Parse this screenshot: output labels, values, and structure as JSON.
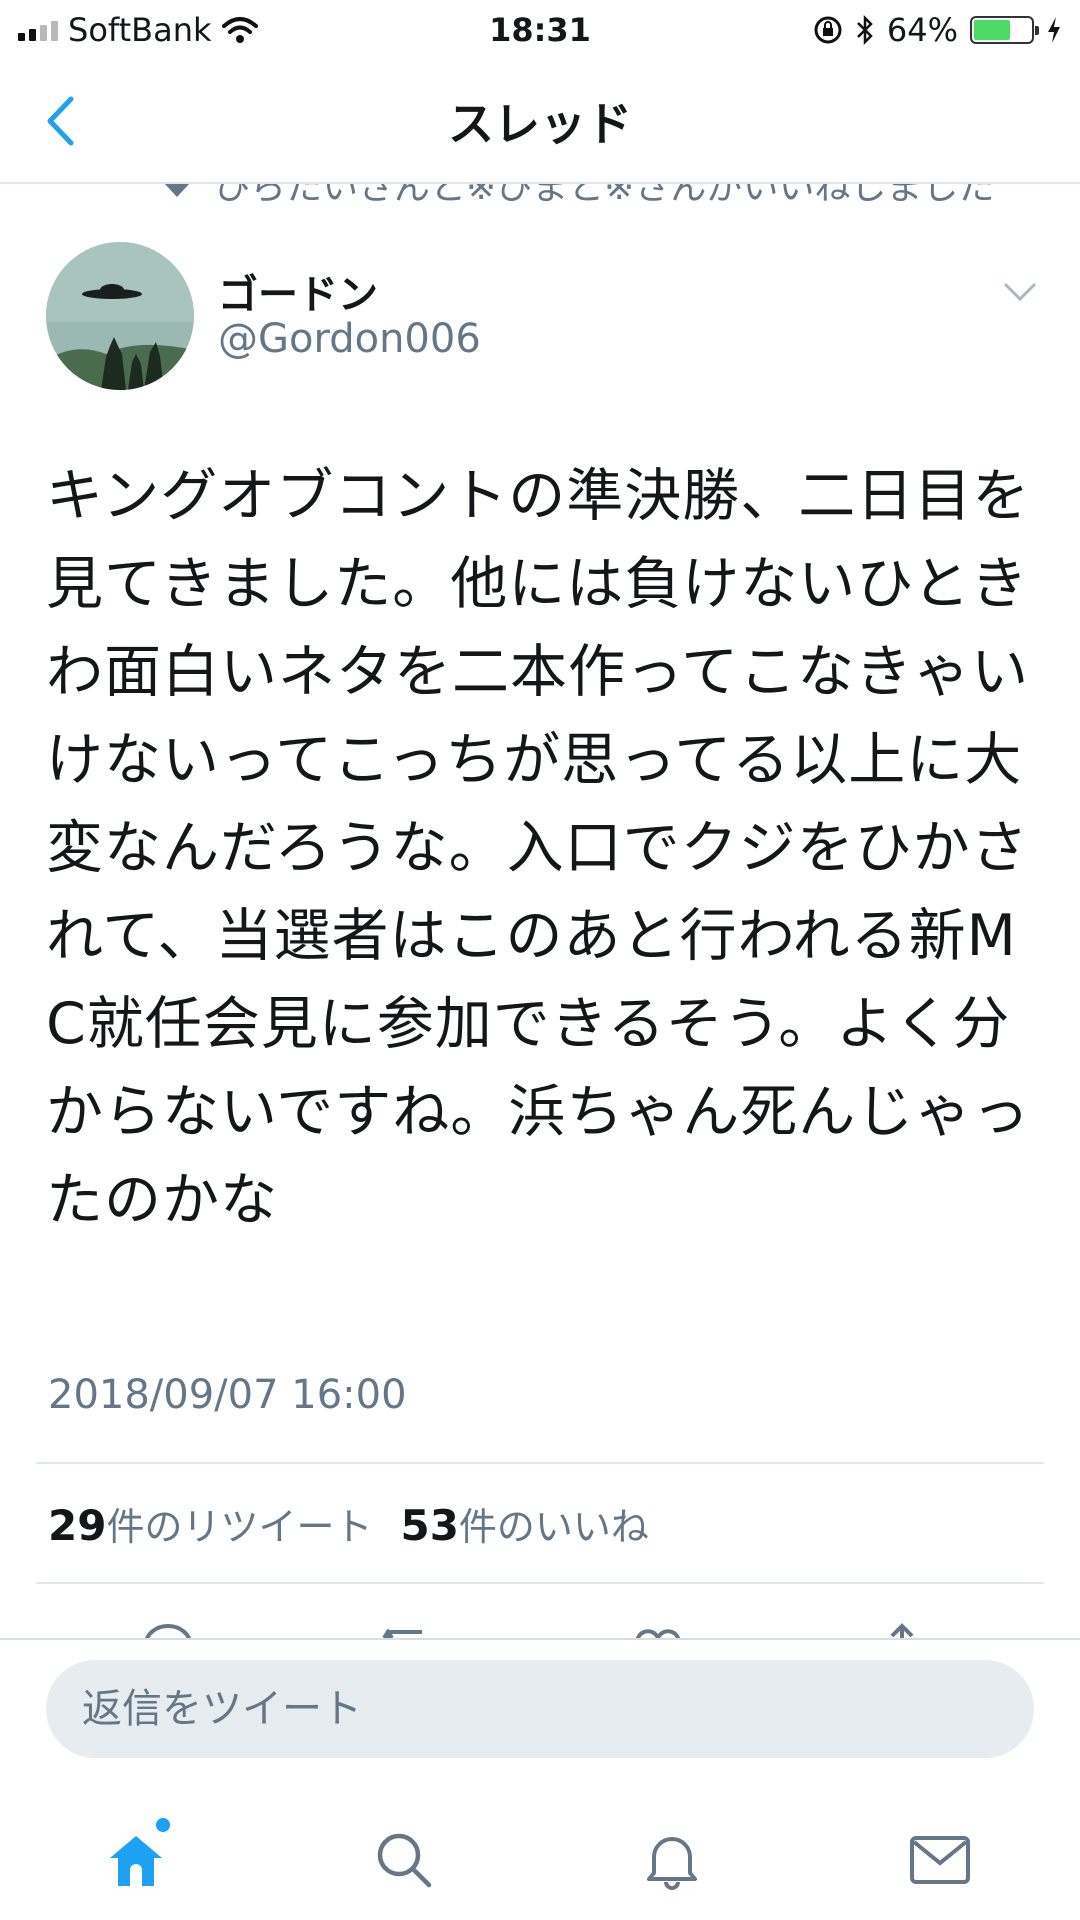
{
  "status_bar": {
    "carrier": "SoftBank",
    "time": "18:31",
    "battery_percent": "64%",
    "battery_level": 0.64
  },
  "header": {
    "title": "スレッド"
  },
  "liked_by": {
    "text": "ひらたいさんと※ひまと※さんがいいねしました"
  },
  "tweet": {
    "display_name": "ゴードン",
    "handle": "@Gordon006",
    "text": "キングオブコントの準決勝、二日目を見てきました。他には負けないひときわ面白いネタを二本作ってこなきゃいけないってこっちが思ってる以上に大変なんだろうな。入口でクジをひかされて、当選者はこのあと行われる新MC就任会見に参加できるそう。よく分からないですね。浜ちゃん死んじゃったのかな",
    "timestamp": "2018/09/07 16:00",
    "retweet_count": "29",
    "retweet_label": "件のリツイート",
    "like_count": "53",
    "like_label": "件のいいね"
  },
  "composer": {
    "placeholder": "返信をツイート"
  },
  "colors": {
    "accent": "#1da1f2",
    "secondary_text": "#657786",
    "divider": "#e1e8ed"
  },
  "icons": [
    "back-chevron-icon",
    "caret-down-icon",
    "reply-icon",
    "retweet-icon",
    "like-icon",
    "share-icon",
    "home-icon",
    "search-icon",
    "bell-icon",
    "mail-icon"
  ]
}
